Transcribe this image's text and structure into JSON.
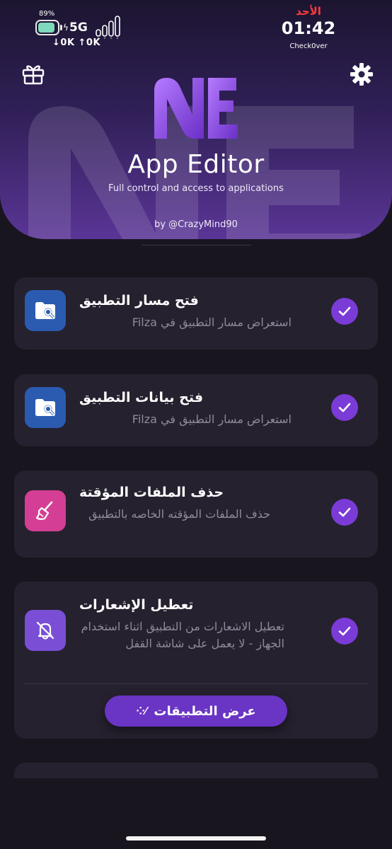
{
  "status_bar": {
    "battery_percent": "89%",
    "battery_level": 0.89,
    "network": "5G",
    "speed": "↓0K ↑0K",
    "day": "الأحد",
    "time": "01:42",
    "carrier": "Check0ver"
  },
  "header": {
    "app_title": "App Editor",
    "subtitle": "Full control and access to applications",
    "author": "by @CrazyMind90"
  },
  "actions": [
    {
      "title": "فتح مسار التطبيق",
      "description": "استعراض مسار التطبيق في Filza",
      "icon": "folder-search-icon",
      "enabled": true
    },
    {
      "title": "فتح بيانات التطبيق",
      "description": "استعراض مسار التطبيق في Filza",
      "icon": "folder-search-icon",
      "enabled": true
    },
    {
      "title": "حذف الملفات المؤقتة",
      "description": "حذف الملفات المؤقته الخاصه بالتطبيق",
      "icon": "broom-icon",
      "enabled": true
    },
    {
      "title": "تعطيل الإشعارات",
      "description": "تعطيل الاشعارات من التطبيق اثناء استخدام الجهاز - لا يعمل على شاشة القفل",
      "icon": "bell-slash-icon",
      "enabled": true
    }
  ],
  "apps_button": {
    "label": "عرض التطبيقات",
    "icon": "sparkle-icon"
  },
  "colors": {
    "background": "#18151f",
    "card": "#25212e",
    "accent": "#7a3bd6",
    "header_gradient_end": "#5a3596"
  }
}
